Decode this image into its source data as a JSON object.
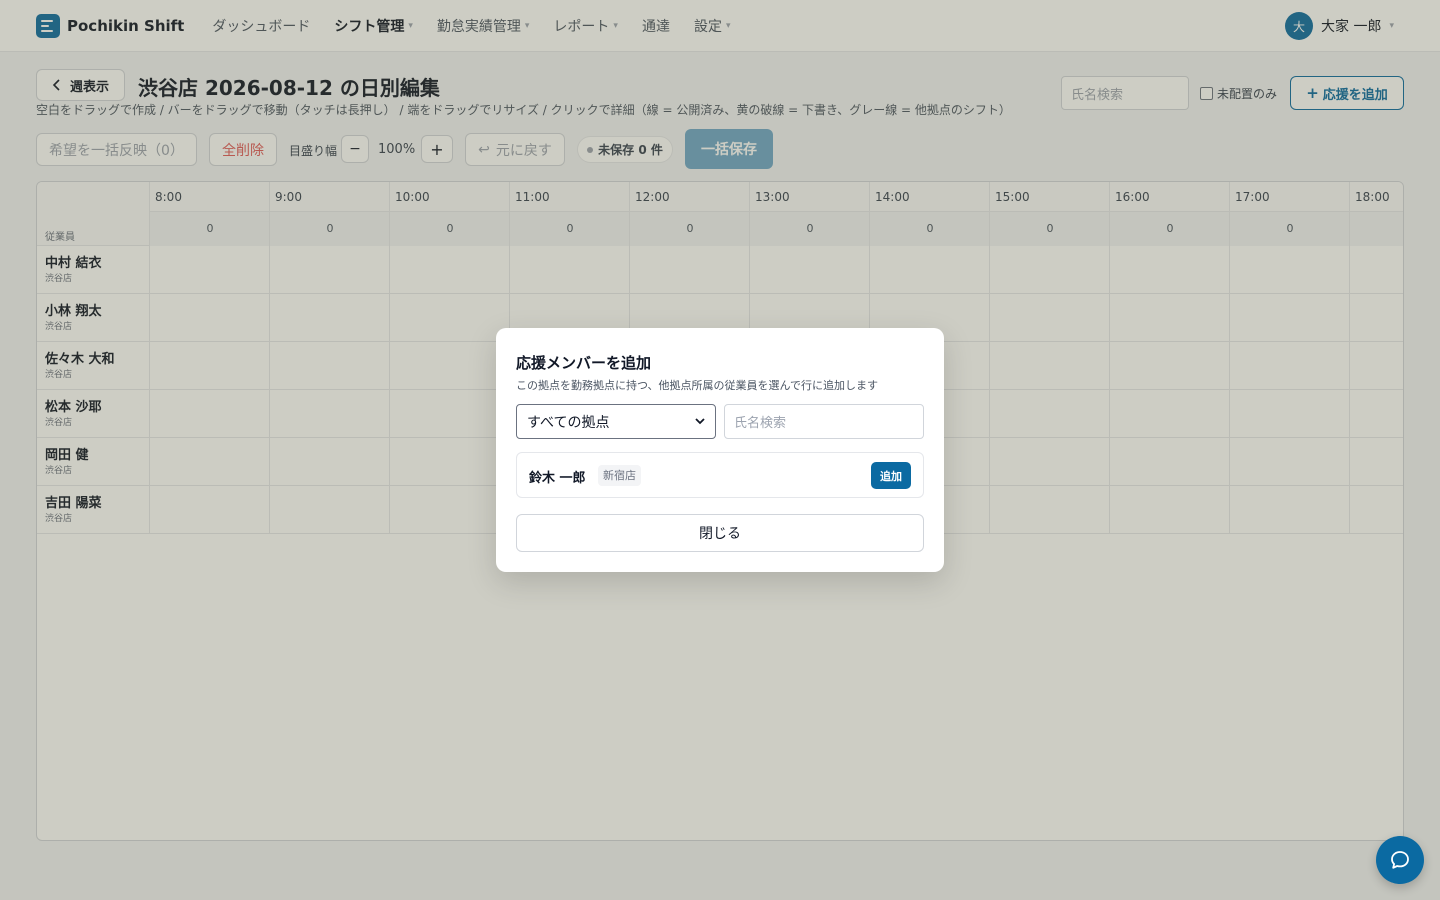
{
  "app": {
    "brand": "Pochikin Shift"
  },
  "nav": {
    "items": [
      {
        "label": "ダッシュボード",
        "has_menu": false,
        "active": false
      },
      {
        "label": "シフト管理",
        "has_menu": true,
        "active": true
      },
      {
        "label": "勤怠実績管理",
        "has_menu": true,
        "active": false
      },
      {
        "label": "レポート",
        "has_menu": true,
        "active": false
      },
      {
        "label": "通達",
        "has_menu": false,
        "active": false
      },
      {
        "label": "設定",
        "has_menu": true,
        "active": false
      }
    ]
  },
  "user": {
    "initial": "大",
    "name": "大家 一郎"
  },
  "page": {
    "back_label": "週表示",
    "title": "渋谷店 2026-08-12 の日別編集",
    "hint": "空白をドラッグで作成 / バーをドラッグで移動（タッチは長押し） / 端をドラッグでリサイズ / クリックで詳細（線 = 公開済み、黄の破線 = 下書き、グレー線 = 他拠点のシフト）",
    "search_placeholder": "氏名検索",
    "unassigned_label": "未配置のみ",
    "add_support_label": "応援を追加"
  },
  "toolbar": {
    "apply_requests": "希望を一括反映（0）",
    "delete_all": "全削除",
    "scale_label": "目盛り幅",
    "zoom_out": "−",
    "zoom_value": "100%",
    "zoom_in": "+",
    "undo": "元に戻す",
    "unsaved": "未保存 0 件",
    "save_all": "一括保存"
  },
  "grid": {
    "employee_header": "従業員",
    "hours": [
      {
        "label": "8:00",
        "count": "0"
      },
      {
        "label": "9:00",
        "count": "0"
      },
      {
        "label": "10:00",
        "count": "0"
      },
      {
        "label": "11:00",
        "count": "0"
      },
      {
        "label": "12:00",
        "count": "0"
      },
      {
        "label": "13:00",
        "count": "0"
      },
      {
        "label": "14:00",
        "count": "0"
      },
      {
        "label": "15:00",
        "count": "0"
      },
      {
        "label": "16:00",
        "count": "0"
      },
      {
        "label": "17:00",
        "count": "0"
      },
      {
        "label": "18:00",
        "count": ""
      }
    ],
    "employees": [
      {
        "name": "中村 結衣",
        "store": "渋谷店"
      },
      {
        "name": "小林 翔太",
        "store": "渋谷店"
      },
      {
        "name": "佐々木 大和",
        "store": "渋谷店"
      },
      {
        "name": "松本 沙耶",
        "store": "渋谷店"
      },
      {
        "name": "岡田 健",
        "store": "渋谷店"
      },
      {
        "name": "吉田 陽菜",
        "store": "渋谷店"
      }
    ]
  },
  "modal": {
    "title": "応援メンバーを追加",
    "description": "この拠点を勤務拠点に持つ、他拠点所属の従業員を選んで行に追加します",
    "store_select": "すべての拠点",
    "search_placeholder": "氏名検索",
    "candidates": [
      {
        "name": "鈴木 一郎",
        "store": "新宿店",
        "add_label": "追加"
      }
    ],
    "close_label": "閉じる"
  },
  "colors": {
    "accent": "#0b6aa2",
    "danger": "#e15b5b"
  },
  "icons": {
    "chat": "chat-bubble-icon",
    "back": "chevron-left-icon",
    "undo": "undo-arrow-icon"
  }
}
